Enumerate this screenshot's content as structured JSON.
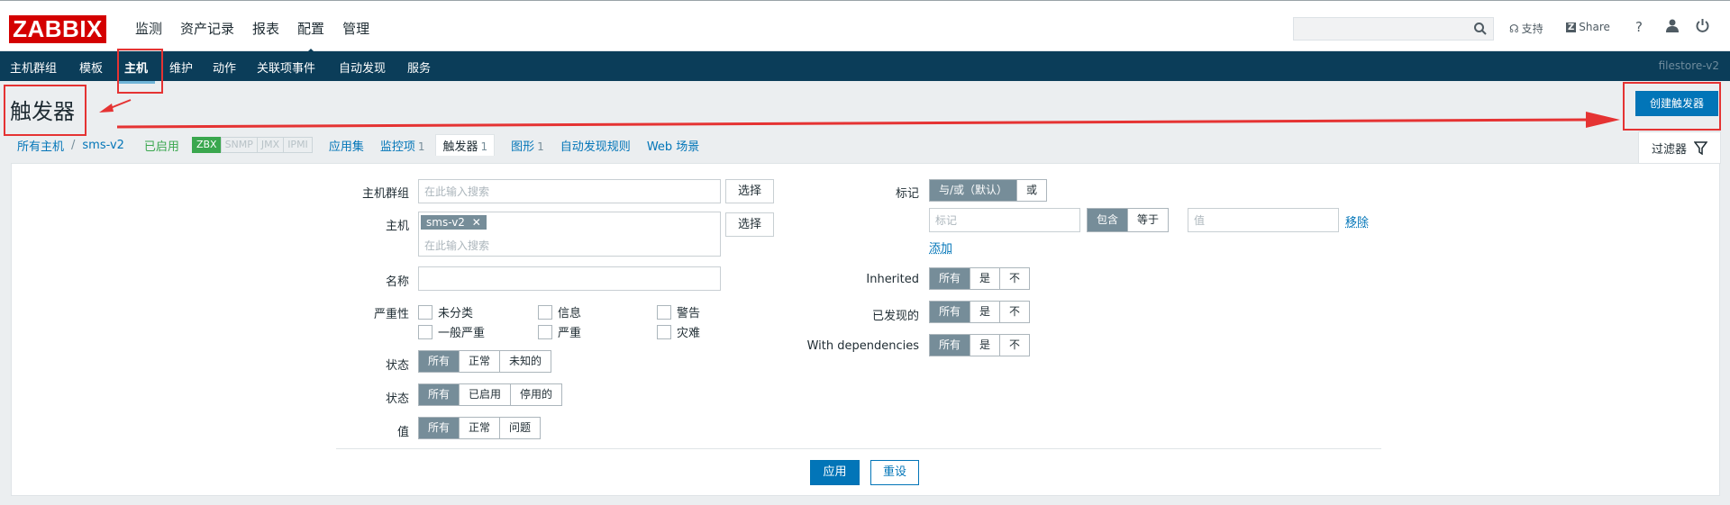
{
  "header": {
    "logo": "ZABBIX",
    "main_nav": [
      "监测",
      "资产记录",
      "报表",
      "配置",
      "管理"
    ],
    "support_label": "支持",
    "share_label": "Share",
    "help_label": "?"
  },
  "subnav": {
    "items": [
      "主机群组",
      "模板",
      "主机",
      "维护",
      "动作",
      "关联项事件",
      "自动发现",
      "服务"
    ],
    "server_name": "filestore-v2"
  },
  "page": {
    "title": "触发器",
    "create_button": "创建触发器"
  },
  "breadcrumb": {
    "all_hosts": "所有主机",
    "separator": "/",
    "host": "sms-v2",
    "status": "已启用",
    "tags": [
      "ZBX",
      "SNMP",
      "JMX",
      "IPMI"
    ],
    "tabs": [
      {
        "label": "应用集",
        "count": ""
      },
      {
        "label": "监控项",
        "count": "1"
      },
      {
        "label": "触发器",
        "count": "1"
      },
      {
        "label": "图形",
        "count": "1"
      },
      {
        "label": "自动发现规则",
        "count": ""
      },
      {
        "label": "Web 场景",
        "count": ""
      }
    ]
  },
  "filter": {
    "tab_label": "过滤器",
    "host_groups_label": "主机群组",
    "host_groups_placeholder": "在此输入搜索",
    "select_label": "选择",
    "host_label": "主机",
    "host_chip": "sms-v2",
    "host_placeholder": "在此输入搜索",
    "name_label": "名称",
    "severity_label": "严重性",
    "severities": [
      "未分类",
      "信息",
      "警告",
      "一般严重",
      "严重",
      "灾难"
    ],
    "state_label": "状态",
    "state_options": [
      "所有",
      "正常",
      "未知的"
    ],
    "status_label": "状态",
    "status_options": [
      "所有",
      "已启用",
      "停用的"
    ],
    "value_label": "值",
    "value_options": [
      "所有",
      "正常",
      "问题"
    ],
    "tags_label": "标记",
    "tags_mode": [
      "与/或（默认）",
      "或"
    ],
    "tag_placeholder": "标记",
    "tag_operator": [
      "包含",
      "等于"
    ],
    "tag_value_placeholder": "值",
    "remove_label": "移除",
    "add_label": "添加",
    "inherited_label": "Inherited",
    "discovered_label": "已发现的",
    "dependencies_label": "With dependencies",
    "tri_options": [
      "所有",
      "是",
      "不"
    ],
    "apply_label": "应用",
    "reset_label": "重设"
  }
}
